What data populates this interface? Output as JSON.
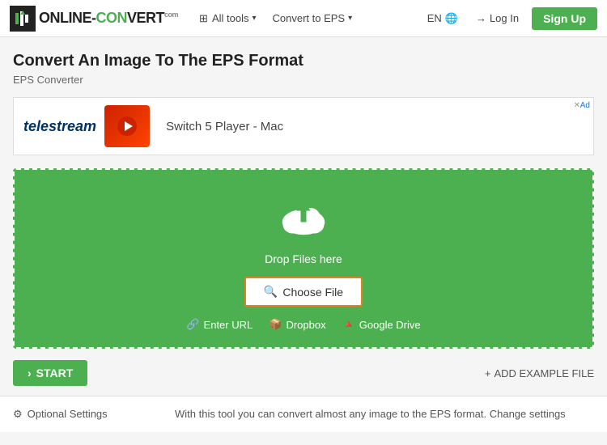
{
  "header": {
    "logo_text_main": "ONLINE-CONVERT",
    "logo_com": "com",
    "nav": {
      "all_tools": "All tools",
      "convert_to_eps": "Convert to EPS"
    },
    "lang": "EN",
    "login": "Log In",
    "signup": "Sign Up"
  },
  "page": {
    "title": "Convert An Image To The EPS Format",
    "subtitle": "EPS Converter"
  },
  "ad": {
    "label": "Ad",
    "advertiser": "telestream",
    "product": "Switch 5 Player - Mac"
  },
  "upload": {
    "drop_text": "Drop Files here",
    "choose_file_label": "Choose File",
    "enter_url": "Enter URL",
    "dropbox": "Dropbox",
    "google_drive": "Google Drive"
  },
  "actions": {
    "start": "START",
    "add_example": "ADD EXAMPLE FILE"
  },
  "settings": {
    "optional_label": "Optional Settings",
    "description": "With this tool you can convert almost any image to the EPS format. Change settings"
  },
  "icons": {
    "chevron": "▾",
    "search": "🔍",
    "link": "🔗",
    "dropbox_icon": "📦",
    "gdrive_icon": "🔺",
    "gear": "⚙",
    "plus": "+",
    "chevron_right": "›",
    "globe": "🌐",
    "login_arrow": "→"
  }
}
